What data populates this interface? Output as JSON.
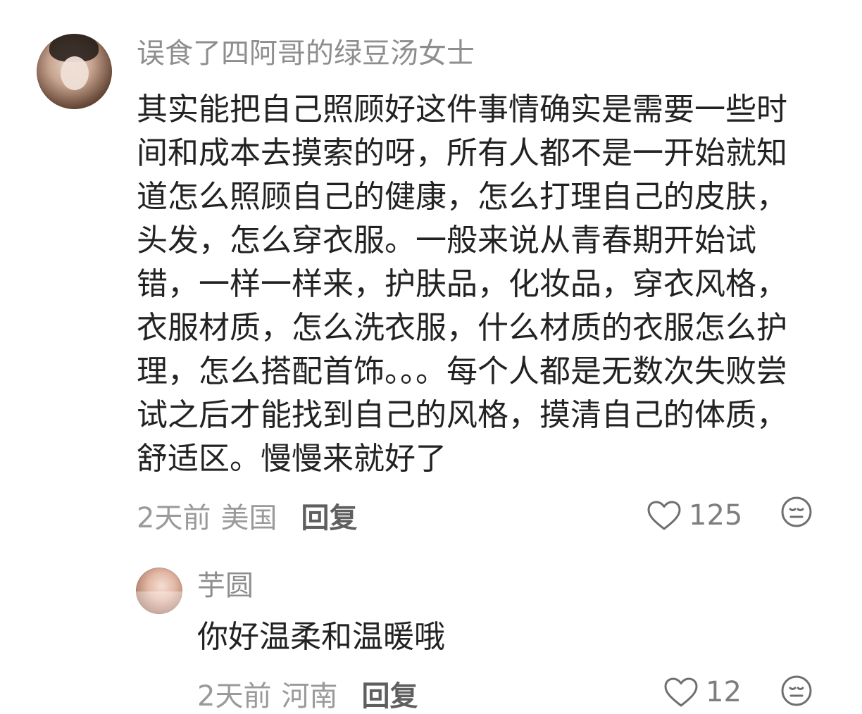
{
  "comments": [
    {
      "username": "误食了四阿哥的绿豆汤女士",
      "text": "其实能把自己照顾好这件事情确实是需要一些时间和成本去摸索的呀，所有人都不是一开始就知道怎么照顾自己的健康，怎么打理自己的皮肤，头发，怎么穿衣服。一般来说从青春期开始试错，一样一样来，护肤品，化妆品，穿衣风格，衣服材质，怎么洗衣服，什么材质的衣服怎么护理，怎么搭配首饰。。。每个人都是无数次失败尝试之后才能找到自己的风格，摸清自己的体质，舒适区。慢慢来就好了",
      "time": "2天前",
      "location": "美国",
      "reply_label": "回复",
      "likes": "125",
      "icons": {
        "like": "heart-outline-icon",
        "dislike": "neutral-face-icon"
      }
    },
    {
      "username": "芋圆",
      "text": "你好温柔和温暖哦",
      "time": "2天前",
      "location": "河南",
      "reply_label": "回复",
      "likes": "12",
      "icons": {
        "like": "heart-outline-icon",
        "dislike": "neutral-face-icon"
      }
    }
  ],
  "colors": {
    "username": "#8e8e8e",
    "text": "#222222",
    "meta": "#9a9a9a",
    "reply": "#5f5f5f",
    "icon": "#6f6f6f"
  }
}
